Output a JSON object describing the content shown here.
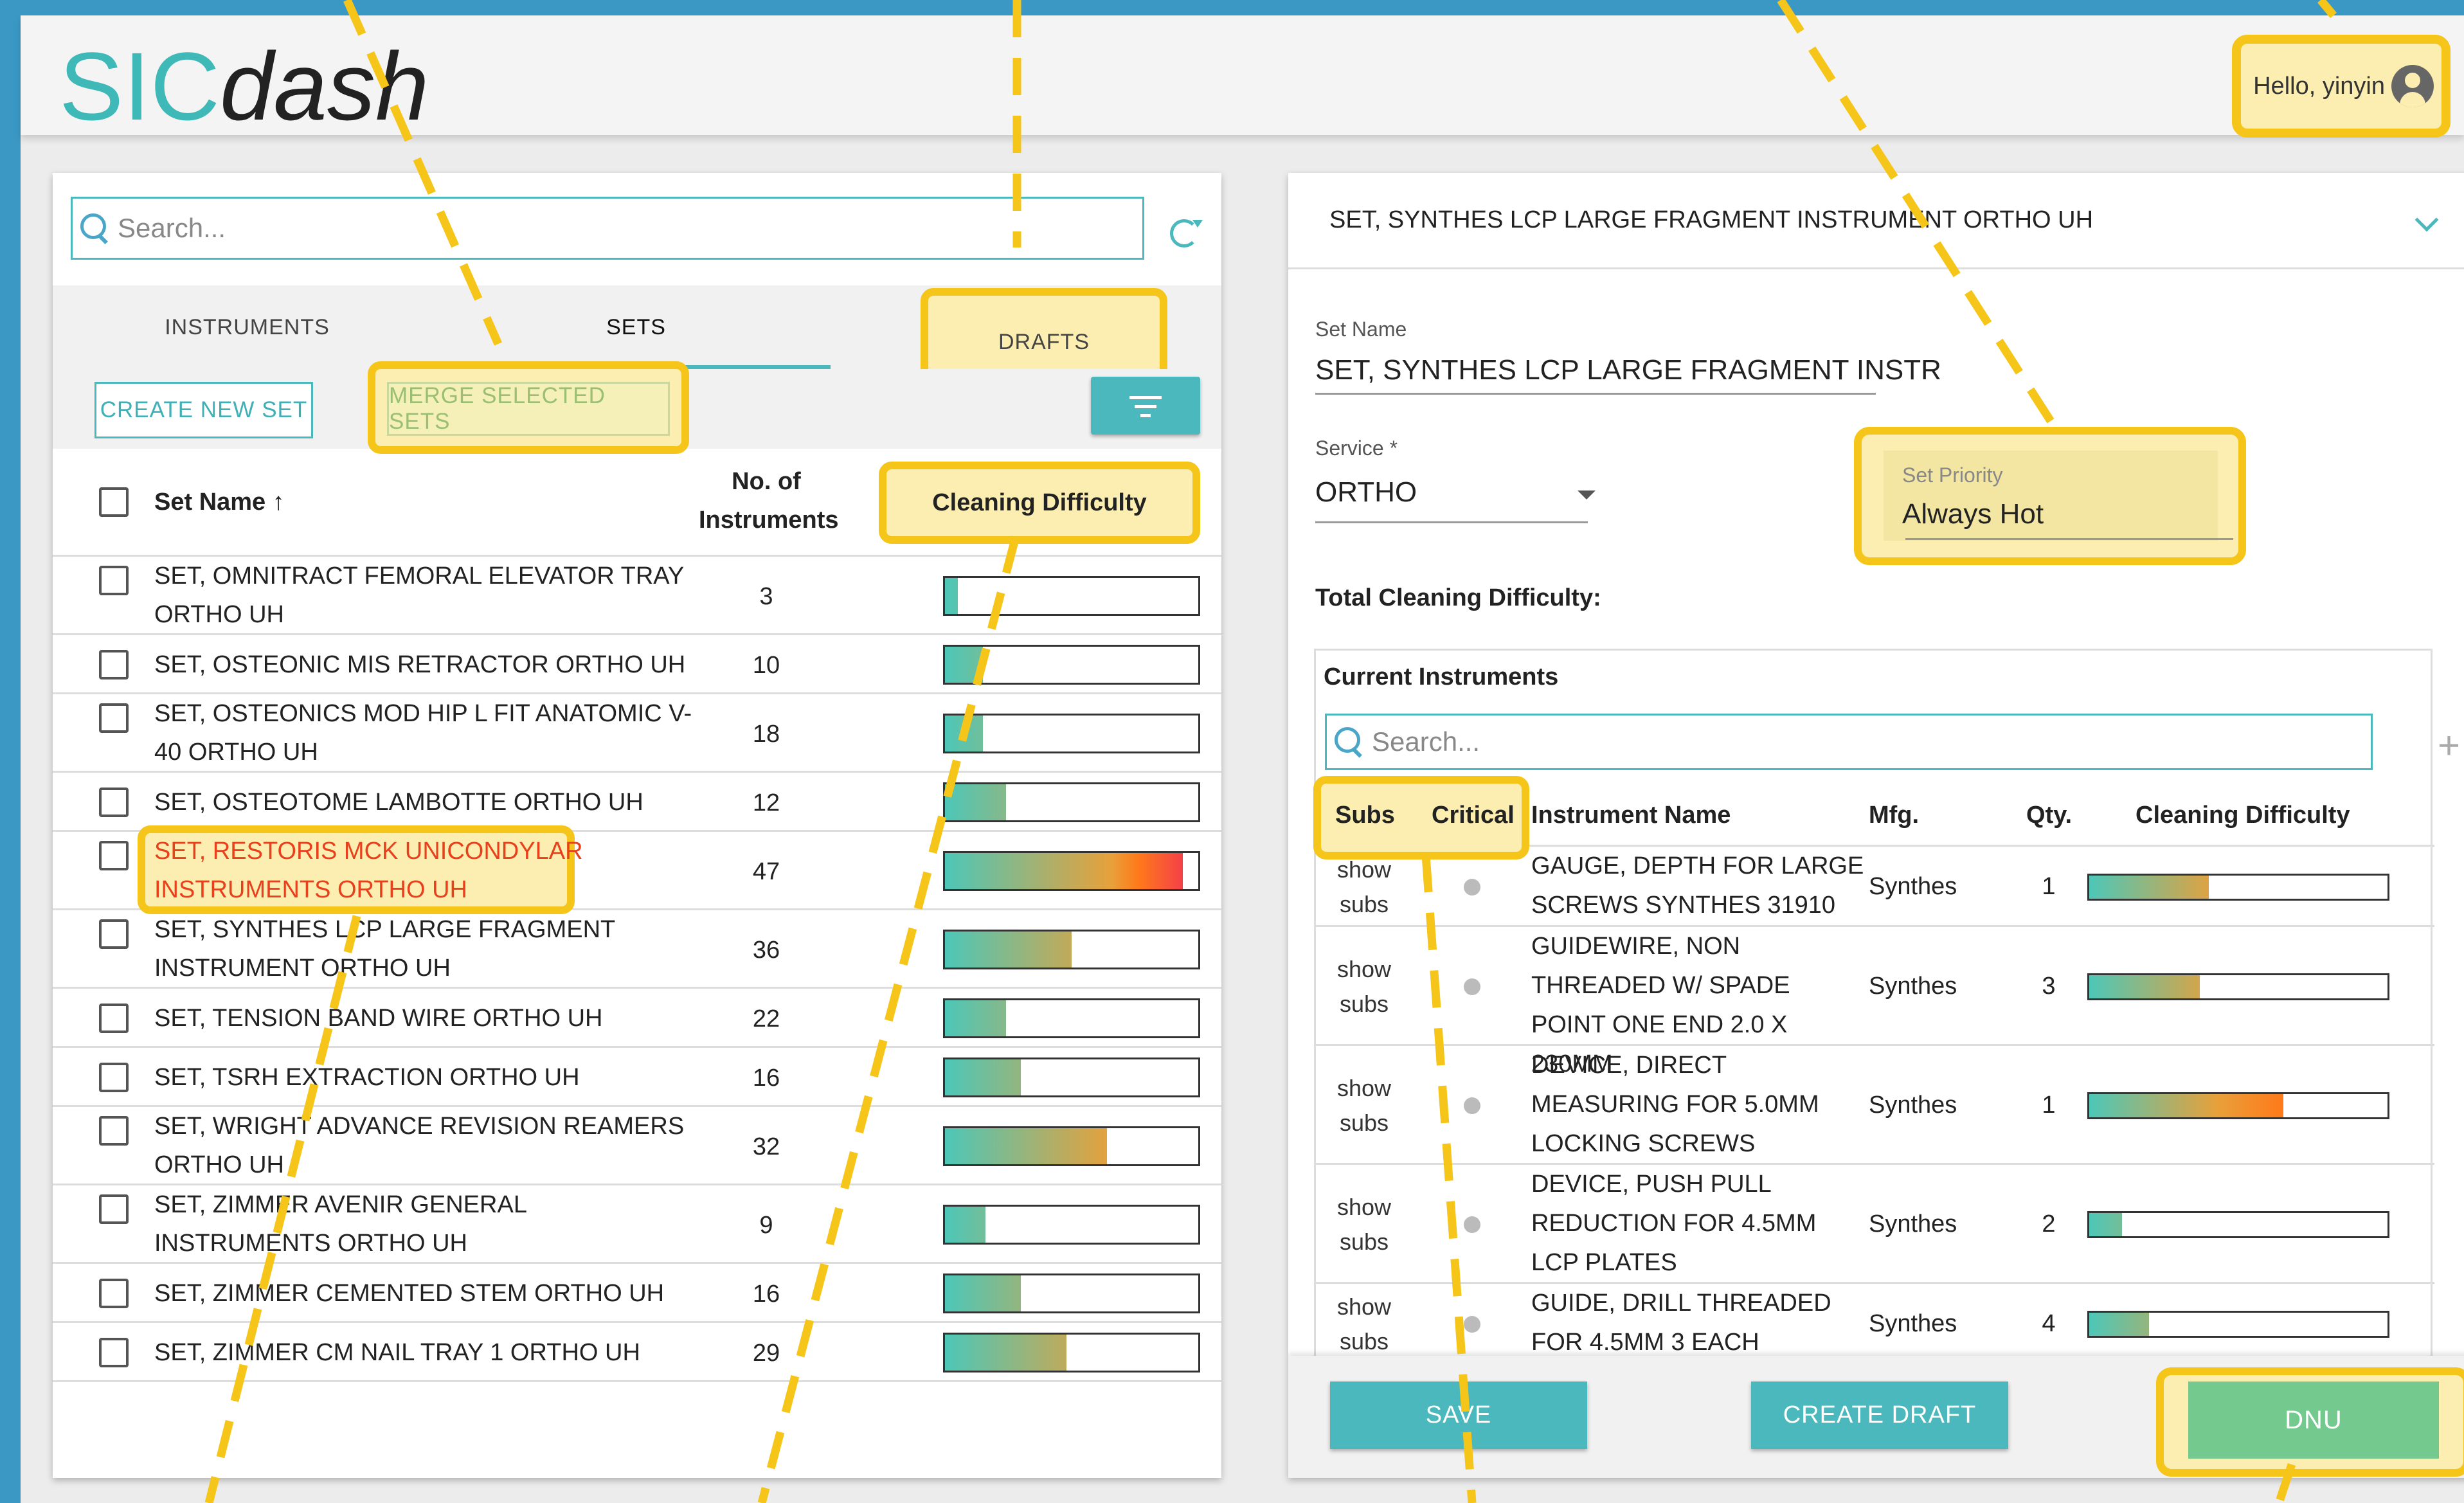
{
  "header": {
    "logo_part1": "SIC",
    "logo_part2": "dash",
    "greeting": "Hello, yinyin"
  },
  "left_panel": {
    "search_placeholder": "Search...",
    "tabs": [
      "INSTRUMENTS",
      "SETS",
      "DRAFTS"
    ],
    "active_tab": "SETS",
    "create_button": "CREATE NEW SET",
    "merge_button": "MERGE SELECTED SETS",
    "columns": {
      "name": "Set Name ↑",
      "count_line1": "No. of",
      "count_line2": "Instruments",
      "difficulty": "Cleaning Difficulty"
    },
    "rows": [
      {
        "name": "SET, OMNITRACT FEMORAL ELEVATOR TRAY ORTHO UH",
        "count": "3",
        "difficulty": 0.05
      },
      {
        "name": "SET, OSTEONIC MIS RETRACTOR ORTHO UH",
        "count": "10",
        "difficulty": 0.15
      },
      {
        "name": "SET, OSTEONICS MOD HIP L FIT ANATOMIC V-40 ORTHO UH",
        "count": "18",
        "difficulty": 0.15
      },
      {
        "name": "SET, OSTEOTOME LAMBOTTE ORTHO UH",
        "count": "12",
        "difficulty": 0.24
      },
      {
        "name": "SET, RESTORIS MCK UNICONDYLAR INSTRUMENTS ORTHO UH",
        "count": "47",
        "difficulty": 0.94
      },
      {
        "name": "SET, SYNTHES LCP LARGE FRAGMENT INSTRUMENT ORTHO UH",
        "count": "36",
        "difficulty": 0.5
      },
      {
        "name": "SET, TENSION BAND WIRE ORTHO UH",
        "count": "22",
        "difficulty": 0.24
      },
      {
        "name": "SET, TSRH EXTRACTION ORTHO UH",
        "count": "16",
        "difficulty": 0.3
      },
      {
        "name": "SET, WRIGHT ADVANCE REVISION REAMERS ORTHO UH",
        "count": "32",
        "difficulty": 0.64
      },
      {
        "name": "SET, ZIMMER AVENIR GENERAL INSTRUMENTS ORTHO UH",
        "count": "9",
        "difficulty": 0.16
      },
      {
        "name": "SET, ZIMMER CEMENTED STEM ORTHO UH",
        "count": "16",
        "difficulty": 0.3
      },
      {
        "name": "SET, ZIMMER CM NAIL TRAY 1 ORTHO UH",
        "count": "29",
        "difficulty": 0.48
      }
    ]
  },
  "right_panel": {
    "title": "SET, SYNTHES LCP LARGE FRAGMENT INSTRUMENT ORTHO UH",
    "set_name_label": "Set Name",
    "set_name_value": "SET, SYNTHES LCP LARGE FRAGMENT INSTR",
    "service_label": "Service *",
    "service_value": "ORTHO",
    "priority_label": "Set Priority",
    "priority_value": "Always Hot",
    "total_label": "Total Cleaning Difficulty:",
    "current_label": "Current Instruments",
    "search_placeholder": "Search...",
    "columns": {
      "subs": "Subs",
      "critical": "Critical",
      "name": "Instrument Name",
      "mfg": "Mfg.",
      "qty": "Qty.",
      "difficulty": "Cleaning Difficulty"
    },
    "show_subs_1": "show",
    "show_subs_2": "subs",
    "instruments": [
      {
        "name": "GAUGE, DEPTH FOR LARGE SCREWS SYNTHES 31910",
        "mfg": "Synthes",
        "qty": "1",
        "difficulty": 0.4
      },
      {
        "name": "GUIDEWIRE, NON THREADED W/ SPADE POINT ONE END 2.0 X 230MM",
        "mfg": "Synthes",
        "qty": "3",
        "difficulty": 0.37
      },
      {
        "name": "DEVICE, DIRECT MEASURING FOR 5.0MM LOCKING SCREWS",
        "mfg": "Synthes",
        "qty": "1",
        "difficulty": 0.65
      },
      {
        "name": "DEVICE, PUSH PULL REDUCTION FOR 4.5MM LCP PLATES",
        "mfg": "Synthes",
        "qty": "2",
        "difficulty": 0.11
      },
      {
        "name": "GUIDE, DRILL THREADED FOR 4.5MM 3 EACH",
        "mfg": "Synthes",
        "qty": "4",
        "difficulty": 0.2
      }
    ],
    "save_button": "SAVE",
    "draft_button": "CREATE DRAFT",
    "dnu_button": "DNU"
  },
  "colors": {
    "accent": "#4ab8bd",
    "highlight": "#f6c519",
    "highlight_fill": "#fbeeb0",
    "alert_text": "#e8401c",
    "dnu": "#74c98e"
  },
  "icons": [
    "search-icon",
    "refresh-icon",
    "filter-icon",
    "user-avatar-icon",
    "chevron-down-icon",
    "dropdown-caret-icon",
    "add-icon",
    "sort-up-icon"
  ]
}
